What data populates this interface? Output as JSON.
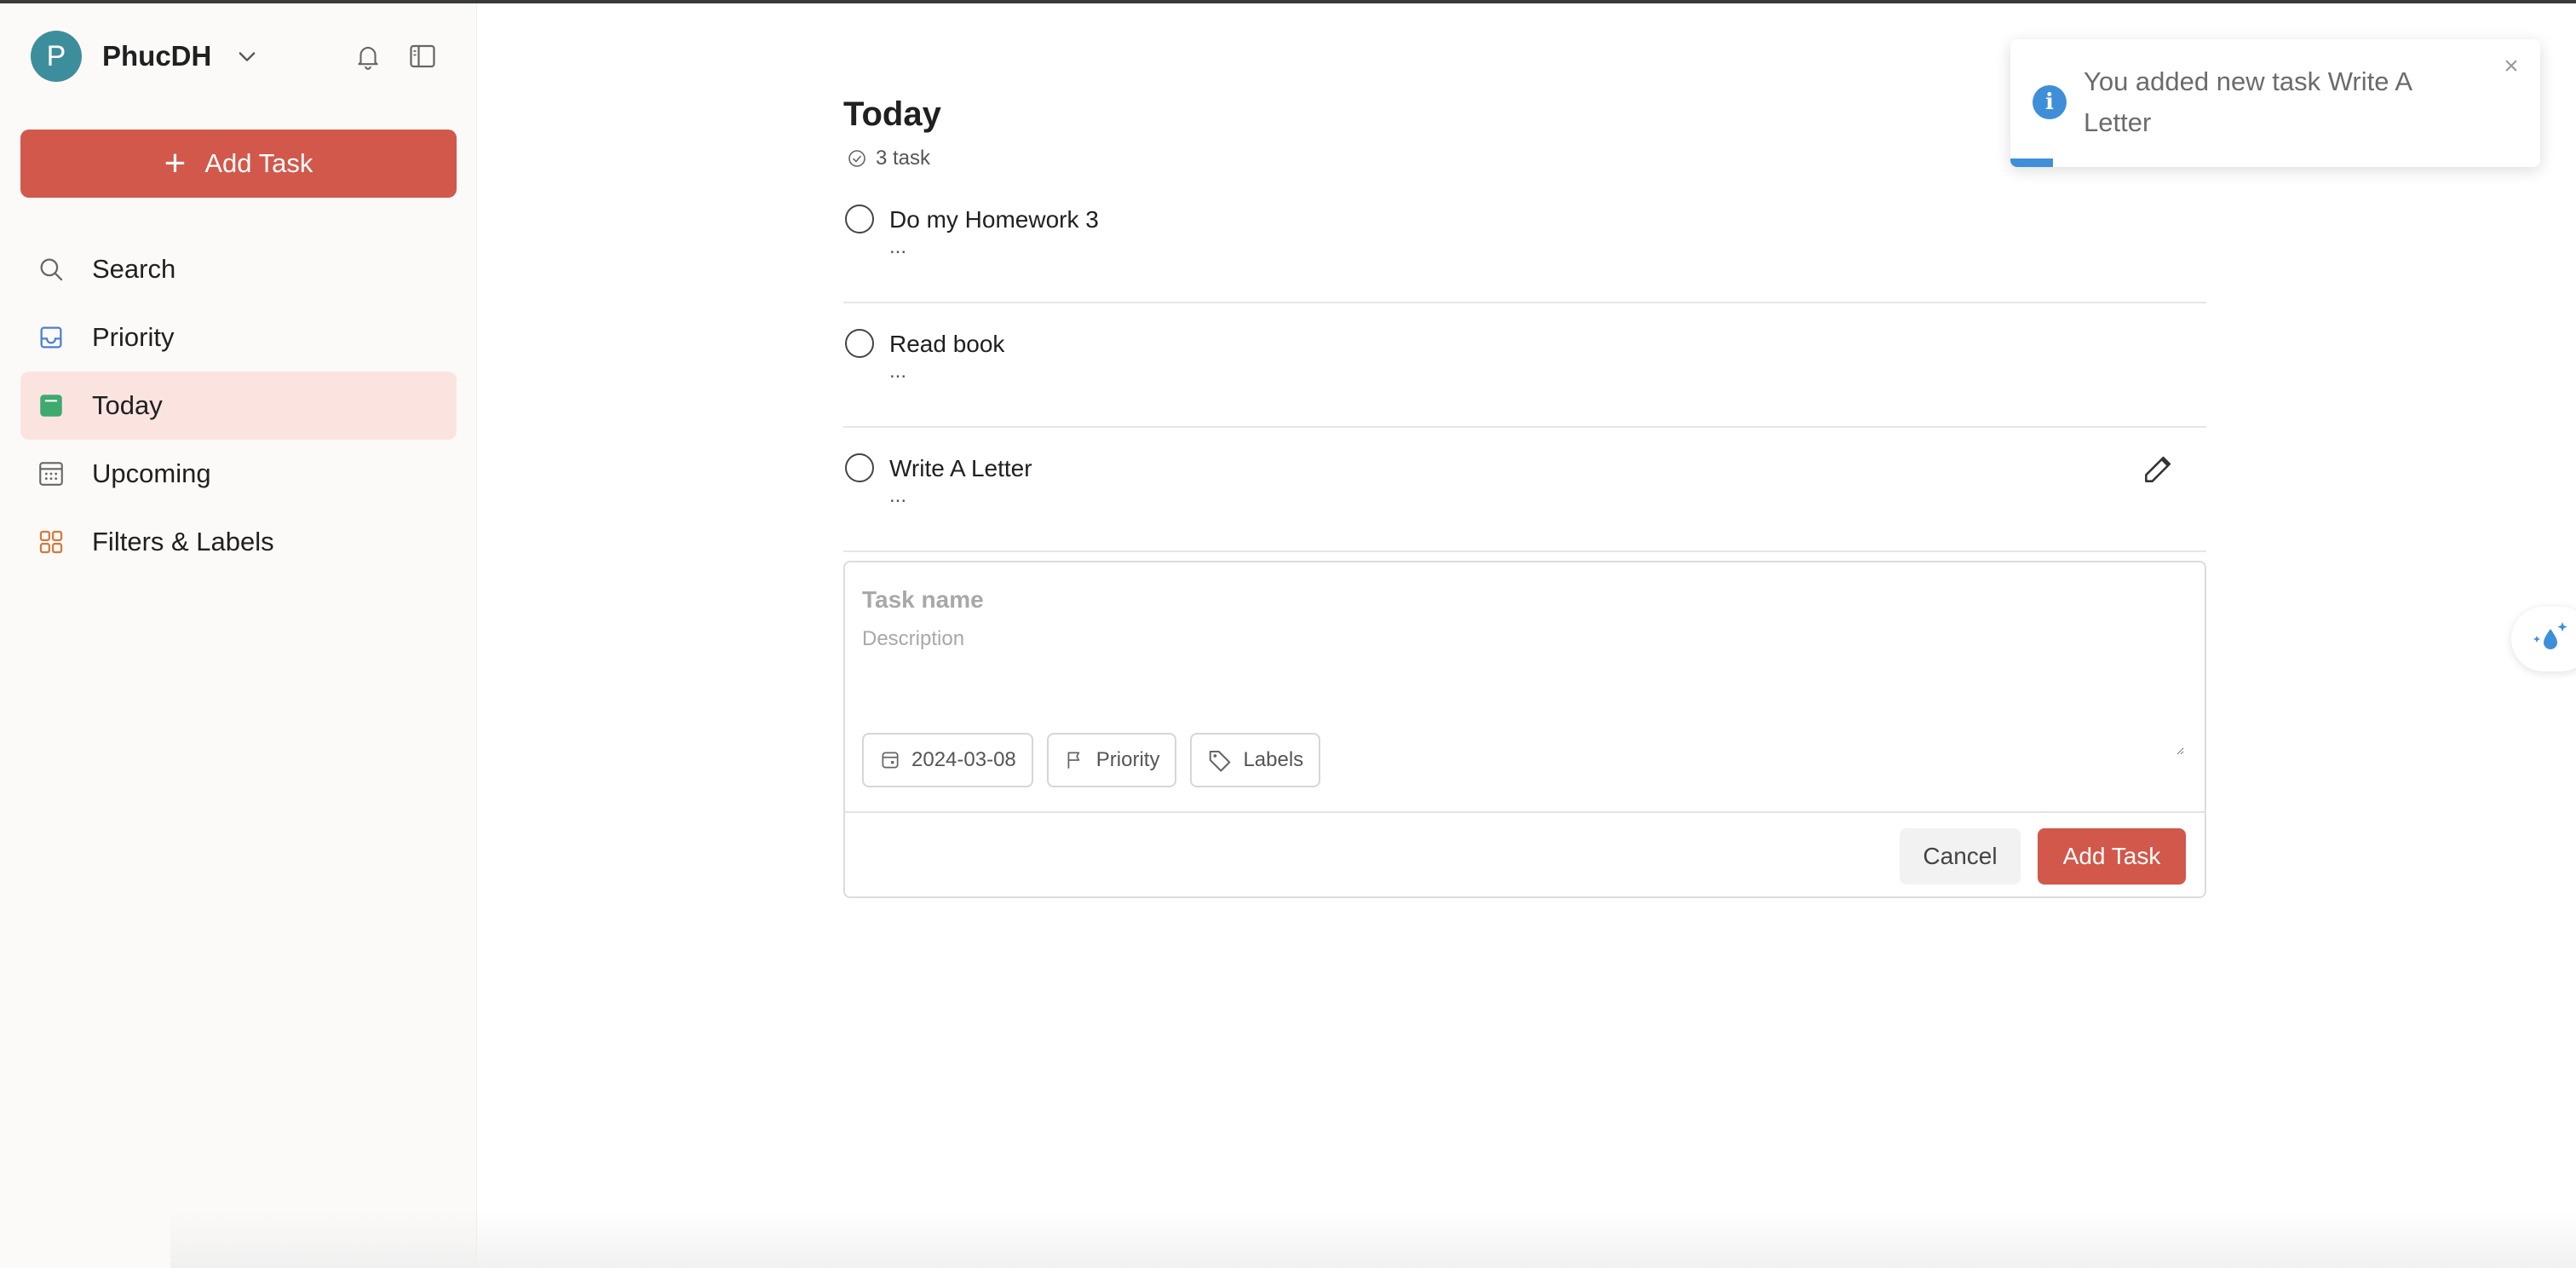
{
  "user": {
    "avatar_letter": "P",
    "name": "PhucDH"
  },
  "sidebar": {
    "add_task_label": "Add Task",
    "items": [
      {
        "label": "Search",
        "icon": "search-icon"
      },
      {
        "label": "Priority",
        "icon": "inbox-icon"
      },
      {
        "label": "Today",
        "icon": "calendar-today-icon",
        "active": true
      },
      {
        "label": "Upcoming",
        "icon": "calendar-grid-icon"
      },
      {
        "label": "Filters & Labels",
        "icon": "grid-icon"
      }
    ]
  },
  "main": {
    "title": "Today",
    "task_count": "3 task",
    "tasks": [
      {
        "name": "Do my Homework 3",
        "description": "..."
      },
      {
        "name": "Read book",
        "description": "..."
      },
      {
        "name": "Write A Letter",
        "description": "..."
      }
    ],
    "editor": {
      "name_placeholder": "Task name",
      "description_placeholder": "Description",
      "date_chip": "2024-03-08",
      "priority_chip": "Priority",
      "labels_chip": "Labels",
      "cancel_label": "Cancel",
      "submit_label": "Add Task"
    }
  },
  "toast": {
    "message": "You added new task Write A Letter",
    "progress": 0.08,
    "close_glyph": "×",
    "info_glyph": "i"
  },
  "colors": {
    "accent": "#d1584a",
    "active_nav_bg": "#fbe4e0",
    "avatar_bg": "#3d8e9c",
    "info_blue": "#3f8fd8"
  }
}
